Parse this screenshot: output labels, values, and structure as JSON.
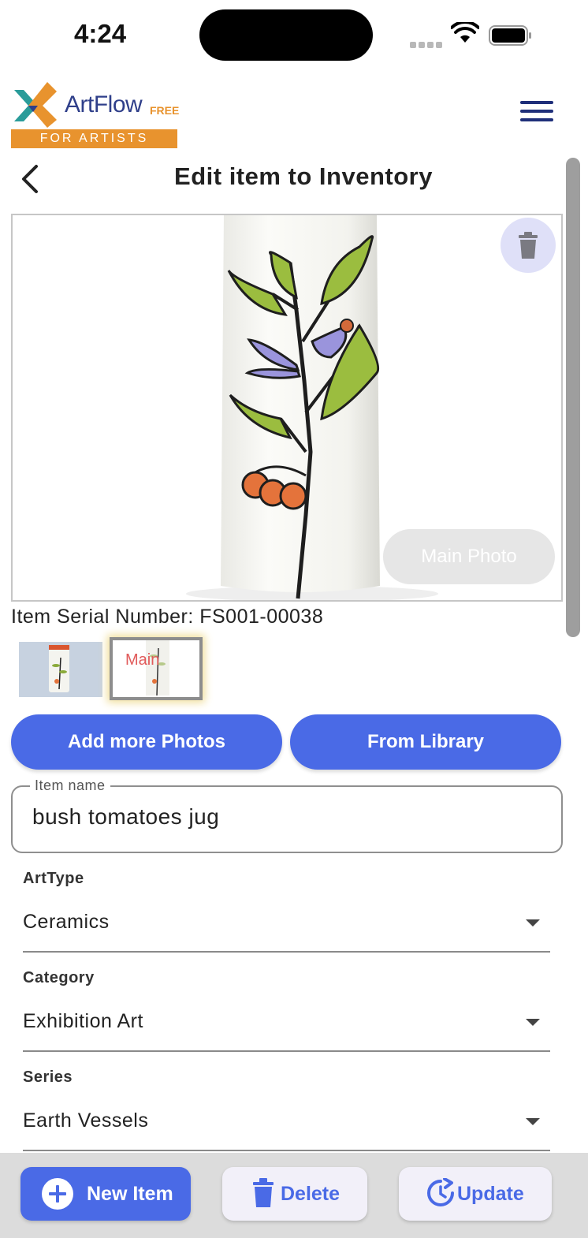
{
  "status_bar": {
    "time": "4:24"
  },
  "header": {
    "logo_name": "ArtFlow",
    "logo_free": "FREE",
    "logo_tagline": "FOR ARTISTS",
    "title": "Edit item to Inventory"
  },
  "photo": {
    "main_photo_label": "Main Photo",
    "thumbnail_main_label": "Main"
  },
  "serial": "Item Serial Number: FS001-00038",
  "actions": {
    "add_photos": "Add more Photos",
    "from_library": "From Library"
  },
  "form": {
    "item_name_label": "Item name",
    "item_name_value": "bush tomatoes jug",
    "dropdowns": [
      {
        "label": "ArtType",
        "value": "Ceramics"
      },
      {
        "label": "Category",
        "value": "Exhibition Art"
      },
      {
        "label": "Series",
        "value": "Earth Vessels"
      }
    ]
  },
  "bottom_bar": {
    "new_item": "New Item",
    "delete": "Delete",
    "update": "Update"
  },
  "colors": {
    "accent": "#4a6ae6",
    "brand_orange": "#e8932e",
    "brand_navy": "#2f3f8a"
  }
}
